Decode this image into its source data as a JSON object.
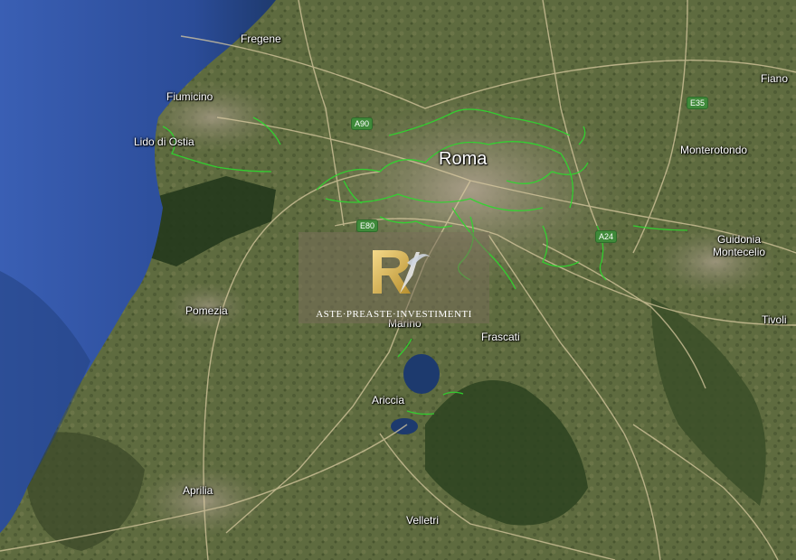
{
  "map": {
    "places": [
      {
        "id": "fregene",
        "name": "Fregene"
      },
      {
        "id": "fiumicino",
        "name": "Fiumicino"
      },
      {
        "id": "lido-di-ostia",
        "name": "Lido di Ostia"
      },
      {
        "id": "roma",
        "name": "Roma"
      },
      {
        "id": "fiano",
        "name": "Fiano"
      },
      {
        "id": "monterotondo",
        "name": "Monterotondo"
      },
      {
        "id": "guidonia",
        "name": "Guidonia\nMontecelio"
      },
      {
        "id": "tivoli",
        "name": "Tivoli"
      },
      {
        "id": "pomezia",
        "name": "Pomezia"
      },
      {
        "id": "marino",
        "name": "Marino"
      },
      {
        "id": "frascati",
        "name": "Frascati"
      },
      {
        "id": "ariccia",
        "name": "Ariccia"
      },
      {
        "id": "aprilia",
        "name": "Aprilia"
      },
      {
        "id": "velletri",
        "name": "Velletri"
      }
    ],
    "road_shields": [
      {
        "id": "a90",
        "name": "A90"
      },
      {
        "id": "e35",
        "name": "E35"
      },
      {
        "id": "e80",
        "name": "E80"
      },
      {
        "id": "a24",
        "name": "A24"
      }
    ],
    "colors": {
      "sea": "#2c4f9e",
      "land": "#5b6a3d",
      "urban": "#9a8f78",
      "forest": "#24391c",
      "highlight": "#2ed82e",
      "road": "#d8c9a0",
      "lake": "#1d3a6e"
    }
  },
  "watermark": {
    "logo_letters": "R",
    "text": "ASTE·PREASTE·INVESTIMENTI"
  }
}
